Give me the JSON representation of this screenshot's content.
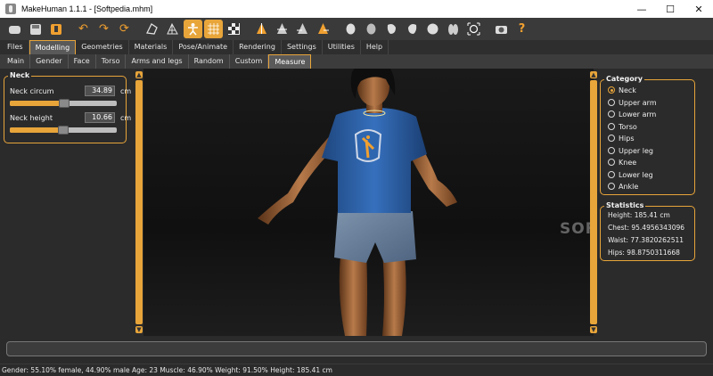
{
  "window": {
    "title": "MakeHuman 1.1.1 - [Softpedia.mhm]",
    "minimize": "—",
    "maximize": "☐",
    "close": "✕"
  },
  "toolbar": {
    "items": [
      {
        "icon": "undo-icon",
        "glyph": "↶"
      },
      {
        "icon": "redo-icon",
        "glyph": "↷"
      },
      {
        "icon": "reset-icon",
        "glyph": "⟳"
      },
      {
        "icon": "smooth-icon",
        "glyph": "⛛"
      },
      {
        "icon": "wireframe-icon",
        "glyph": "⌘"
      },
      {
        "icon": "pose-icon",
        "glyph": "✱"
      },
      {
        "icon": "grid-icon",
        "glyph": "▦"
      },
      {
        "icon": "checker-icon",
        "glyph": "▩"
      }
    ]
  },
  "tabs": [
    {
      "label": "Files",
      "active": false
    },
    {
      "label": "Modelling",
      "active": true
    },
    {
      "label": "Geometries",
      "active": false
    },
    {
      "label": "Materials",
      "active": false
    },
    {
      "label": "Pose/Animate",
      "active": false
    },
    {
      "label": "Rendering",
      "active": false
    },
    {
      "label": "Settings",
      "active": false
    },
    {
      "label": "Utilities",
      "active": false
    },
    {
      "label": "Help",
      "active": false
    }
  ],
  "subtabs": [
    {
      "label": "Main",
      "active": false
    },
    {
      "label": "Gender",
      "active": false
    },
    {
      "label": "Face",
      "active": false
    },
    {
      "label": "Torso",
      "active": false
    },
    {
      "label": "Arms and legs",
      "active": false
    },
    {
      "label": "Random",
      "active": false
    },
    {
      "label": "Custom",
      "active": false
    },
    {
      "label": "Measure",
      "active": true
    }
  ],
  "neck_panel": {
    "title": "Neck",
    "sliders": [
      {
        "label": "Neck circum",
        "value": "34.89",
        "unit": "cm",
        "fraction": 0.46
      },
      {
        "label": "Neck height",
        "value": "10.66",
        "unit": "cm",
        "fraction": 0.45
      }
    ]
  },
  "category_panel": {
    "title": "Category",
    "options": [
      {
        "label": "Neck",
        "checked": true
      },
      {
        "label": "Upper arm",
        "checked": false
      },
      {
        "label": "Lower arm",
        "checked": false
      },
      {
        "label": "Torso",
        "checked": false
      },
      {
        "label": "Hips",
        "checked": false
      },
      {
        "label": "Upper leg",
        "checked": false
      },
      {
        "label": "Knee",
        "checked": false
      },
      {
        "label": "Lower leg",
        "checked": false
      },
      {
        "label": "Ankle",
        "checked": false
      }
    ]
  },
  "statistics_panel": {
    "title": "Statistics",
    "lines": [
      "Height: 185.41 cm",
      "Chest: 95.4956343096",
      "Waist: 77.3820262511",
      "Hips: 98.8750311668"
    ]
  },
  "watermark": "SOFTPEDIA",
  "status": "Gender: 55.10% female, 44.90% male Age: 23 Muscle: 46.90% Weight: 91.50% Height: 185.41 cm",
  "colors": {
    "accent": "#e8a53a",
    "panel": "#2b2b2b",
    "shirt": "#2a5ea8"
  }
}
